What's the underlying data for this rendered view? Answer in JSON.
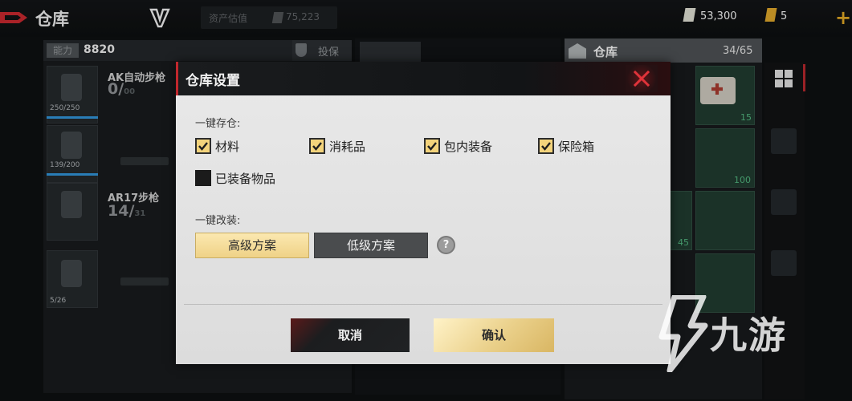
{
  "topbar": {
    "title": "仓库",
    "asset_label": "资产估值",
    "asset_value": "75,223",
    "money": "53,300",
    "tickets": "5"
  },
  "left_panel": {
    "level_tag": "能力",
    "level_value": "8820",
    "insure_label": "投保",
    "slots": [
      {
        "durability": "250/250"
      },
      {
        "durability": "139/200"
      },
      {
        "durability": ""
      },
      {
        "durability": "5/26"
      }
    ],
    "weapons": [
      {
        "name": "AK自动步枪",
        "ammo": "0/",
        "ammo_sub": "00"
      },
      {
        "name": "AR17步枪",
        "ammo": "14/",
        "ammo_sub": "31"
      }
    ]
  },
  "warehouse": {
    "title": "仓库",
    "capacity": "34/65",
    "cells": [
      "15",
      "100",
      "45"
    ]
  },
  "watermark": {
    "text": "九游"
  },
  "dialog": {
    "title": "仓库设置",
    "store_label": "一键存仓:",
    "checkboxes": [
      {
        "label": "材料",
        "checked": true
      },
      {
        "label": "消耗品",
        "checked": true
      },
      {
        "label": "包内装备",
        "checked": true
      },
      {
        "label": "保险箱",
        "checked": true
      },
      {
        "label": "已装备物品",
        "checked": false
      }
    ],
    "mod_label": "一键改装:",
    "plan_high": "高级方案",
    "plan_low": "低级方案",
    "help_glyph": "?",
    "cancel": "取消",
    "confirm": "确认"
  },
  "colors": {
    "accent_red": "#c1272d",
    "check_fill": "#f3d37b",
    "confirm_gold": "#ead08a"
  }
}
